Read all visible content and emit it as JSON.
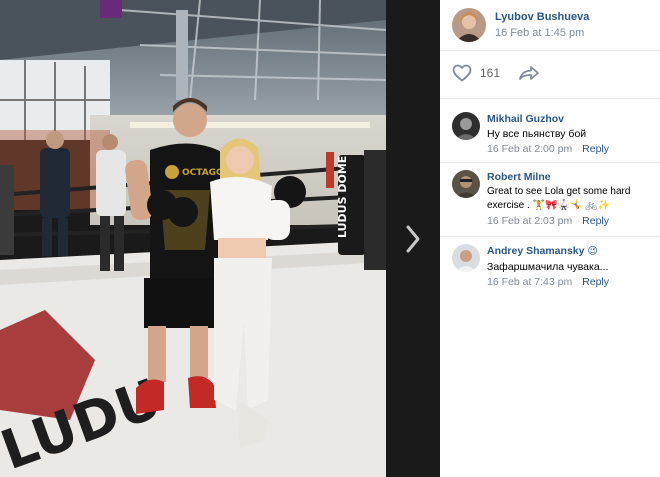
{
  "post": {
    "author_name": "Lyubov Bushueva",
    "date": "16 Feb at 1:45 pm",
    "likes": "161"
  },
  "photo": {
    "banner_text": "LUDUS DOME",
    "shirt_text": "OCTAGON"
  },
  "comments": [
    {
      "name": "Mikhail Guzhov",
      "text": "Ну все пьянству бой",
      "date": "16 Feb at 2:00 pm",
      "reply_label": "Reply"
    },
    {
      "name": "Robert Milne",
      "text": "Great to see Lola get some hard exercise . 🏋🎀🥋🤸 🚲✨",
      "date": "16 Feb at 2:03 pm",
      "reply_label": "Reply"
    },
    {
      "name": "Andrey Shamansky",
      "name_emoji": "😉",
      "text": "Зафаршмачила чувака...",
      "date": "16 Feb at 7:43 pm",
      "reply_label": "Reply"
    }
  ],
  "colors": {
    "link": "#2a5885",
    "muted": "#818c99",
    "divider": "#e7e8ec",
    "viewer_bg": "#1a1a1a"
  },
  "icons": {
    "like": "heart-outline-icon",
    "share": "share-arrow-icon",
    "next": "chevron-right-icon"
  }
}
